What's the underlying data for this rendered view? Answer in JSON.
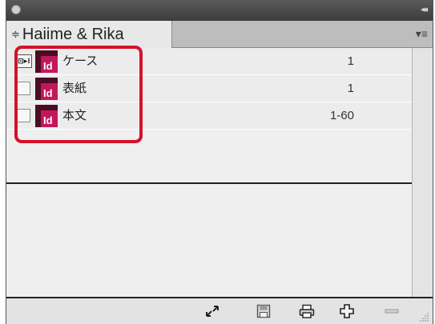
{
  "panel": {
    "tab_label": "Haiime  &  Rika",
    "tab_chevron": "≑",
    "panel_menu_glyph": "▾≡",
    "collapse_glyph": "◂◂"
  },
  "rows": [
    {
      "name": "ケース",
      "pages": "1",
      "icon": "indesign-doc-icon",
      "status_icon": "style-source-icon"
    },
    {
      "name": "表紙",
      "pages": "1",
      "icon": "indesign-doc-icon",
      "status_icon": "checkbox"
    },
    {
      "name": "本文",
      "pages": "1-60",
      "icon": "indesign-doc-icon",
      "status_icon": "checkbox"
    }
  ],
  "indesign_icon": {
    "label": "Id",
    "bg": "#c2185b",
    "dark": "#4a0d21"
  },
  "highlight_color": "#d3122a",
  "toolbar": [
    {
      "name": "synchronize-icon"
    },
    {
      "name": "save-book-icon"
    },
    {
      "name": "print-book-icon"
    },
    {
      "name": "add-document-icon"
    },
    {
      "name": "remove-document-icon"
    }
  ]
}
